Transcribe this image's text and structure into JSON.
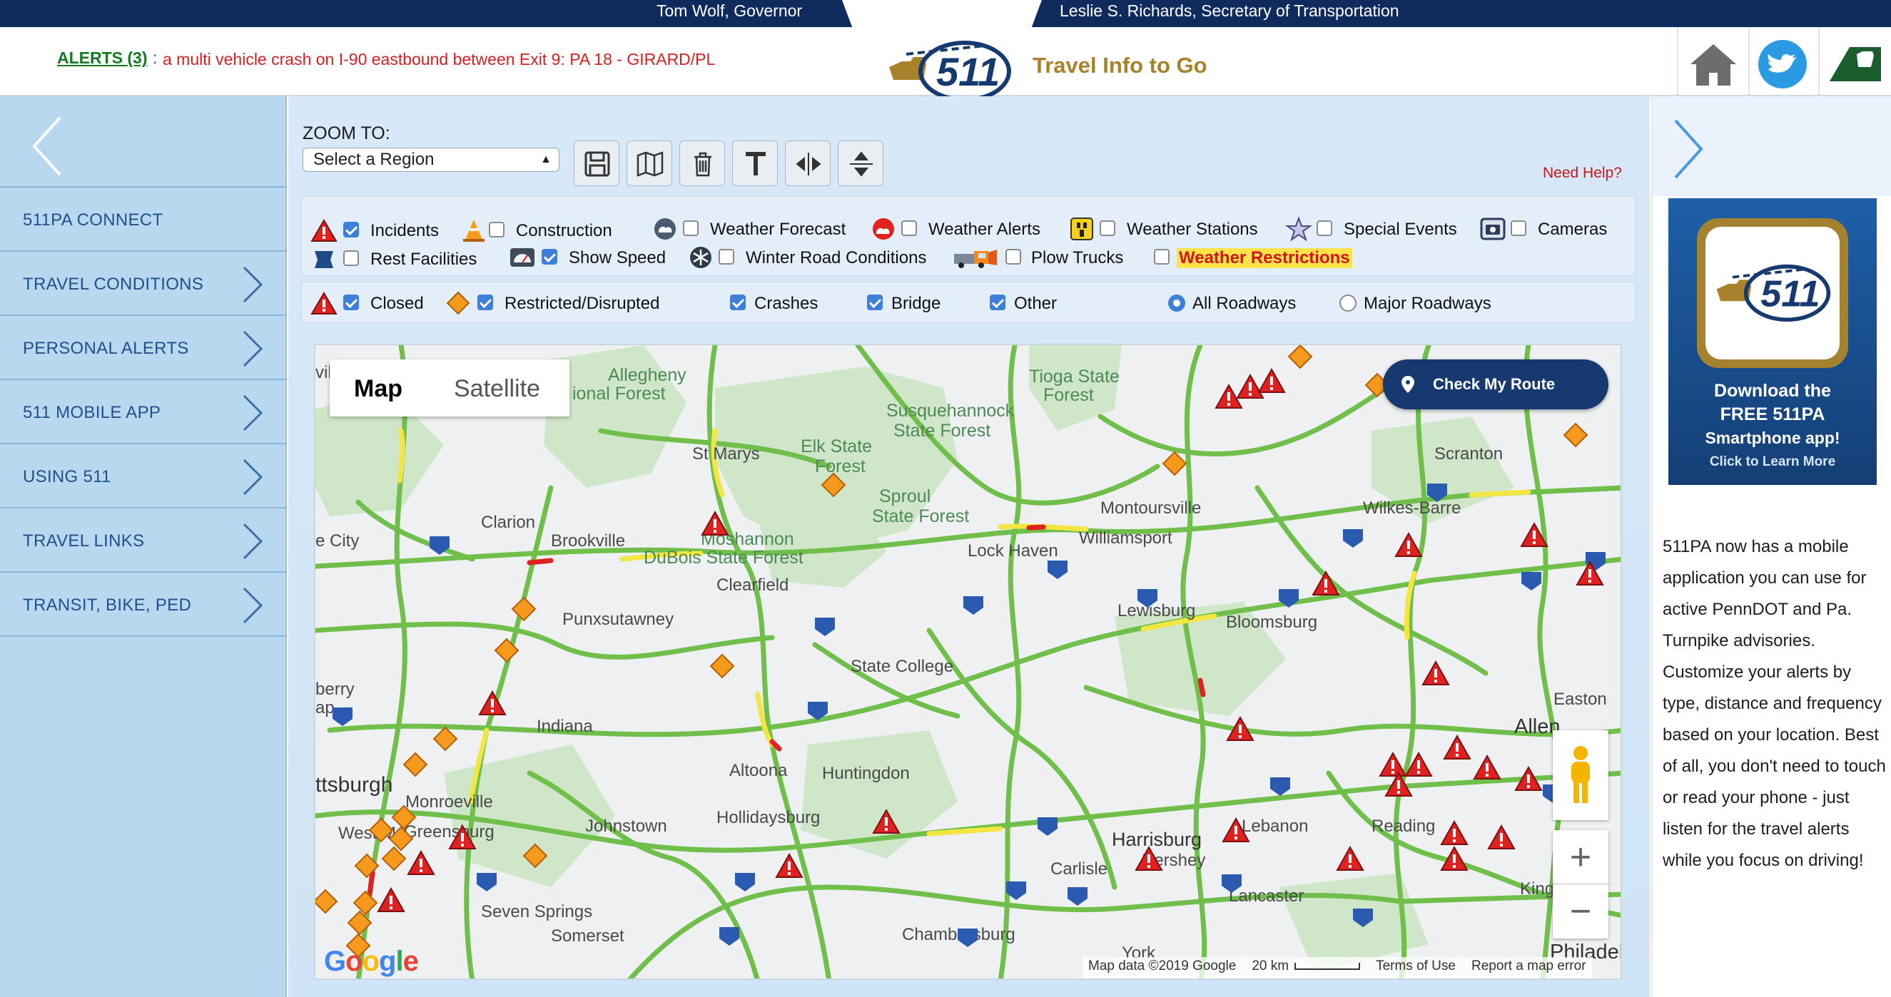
{
  "top_bar": {
    "governor": "Tom Wolf, Governor",
    "secretary": "Leslie S. Richards, Secretary of Transportation"
  },
  "header": {
    "alerts_label": "ALERTS (3)",
    "alerts_colon": ":",
    "alerts_text": "a multi vehicle crash on I-90 eastbound between Exit 9: PA 18 - GIRARD/PL",
    "logo_text": "511",
    "tagline": "Travel Info to Go",
    "icons": [
      "home-icon",
      "twitter-icon",
      "penndot-icon"
    ]
  },
  "sidebar": {
    "items": [
      {
        "label": "511PA CONNECT",
        "chevron": false
      },
      {
        "label": "TRAVEL CONDITIONS",
        "chevron": true
      },
      {
        "label": "PERSONAL ALERTS",
        "chevron": true
      },
      {
        "label": "511 MOBILE APP",
        "chevron": true
      },
      {
        "label": "USING 511",
        "chevron": true
      },
      {
        "label": "TRAVEL LINKS",
        "chevron": true
      },
      {
        "label": "TRANSIT, BIKE, PED",
        "chevron": true
      }
    ]
  },
  "toolbar": {
    "zoom_label": "ZOOM TO:",
    "region_select": "Select a Region",
    "tools": [
      "save-icon",
      "map-icon",
      "trash-icon",
      "text-icon",
      "split-vertical-icon",
      "split-horizontal-icon"
    ],
    "need_help": "Need Help?"
  },
  "layers": {
    "row1": [
      {
        "label": "Incidents",
        "checked": true,
        "icon": "incident-icon"
      },
      {
        "label": "Construction",
        "checked": false,
        "icon": "construction-icon"
      },
      {
        "label": "Weather Forecast",
        "checked": false,
        "icon": "weather-forecast-icon"
      },
      {
        "label": "Weather Alerts",
        "checked": false,
        "icon": "weather-alert-icon"
      },
      {
        "label": "Weather Stations",
        "checked": false,
        "icon": "weather-station-icon"
      },
      {
        "label": "Special Events",
        "checked": false,
        "icon": "star-icon"
      },
      {
        "label": "Cameras",
        "checked": false,
        "icon": "camera-icon"
      }
    ],
    "row2": [
      {
        "label": "Rest Facilities",
        "checked": false,
        "icon": "keystone-icon"
      },
      {
        "label": "Show Speed",
        "checked": true,
        "icon": "speedometer-icon"
      },
      {
        "label": "Winter Road Conditions",
        "checked": false,
        "icon": "snowflake-icon"
      },
      {
        "label": "Plow Trucks",
        "checked": false,
        "icon": "plow-truck-icon"
      },
      {
        "label": "Weather Restrictions",
        "checked": false,
        "icon": ""
      }
    ]
  },
  "filters": {
    "items": [
      {
        "label": "Closed",
        "checked": true,
        "icon": "incident-icon"
      },
      {
        "label": "Restricted/Disrupted",
        "checked": true,
        "icon": "diamond-icon"
      },
      {
        "label": "Crashes",
        "checked": true
      },
      {
        "label": "Bridge",
        "checked": true
      },
      {
        "label": "Other",
        "checked": true
      }
    ],
    "roadways": [
      {
        "label": "All Roadways",
        "selected": true
      },
      {
        "label": "Major Roadways",
        "selected": false
      }
    ]
  },
  "map": {
    "type_tabs": [
      {
        "label": "Map",
        "active": true
      },
      {
        "label": "Satellite",
        "active": false
      }
    ],
    "route_button": "Check My Route",
    "places_large": [
      "Susquehannock",
      "State Forest",
      "Sproul",
      "State Forest",
      "Elk State",
      "Forest",
      "Moshannon",
      "DuBois State Forest",
      "Tioga State",
      "Forest",
      "Allegheny",
      "ional Forest"
    ],
    "places": [
      "St Marys",
      "Clarion",
      "Brookville",
      "Clearfield",
      "Punxsutawney",
      "Lock Haven",
      "Williamsport",
      "Montoursville",
      "Lewisburg",
      "Bloomsburg",
      "Scranton",
      "Wilkes-Barre",
      "State College",
      "Indiana",
      "Altoona",
      "Huntingdon",
      "Johnstown",
      "Hollidaysburg",
      "ttsburgh",
      "Monroeville",
      "West M",
      "Greensburg",
      "Seven Springs",
      "Somerset",
      "Chambersburg",
      "Carlisle",
      "Harrisburg",
      "Hershey",
      "Lebanon",
      "Reading",
      "Lancaster",
      "York",
      "Philadel",
      "Allen",
      "Easton",
      "King",
      "berry",
      "ap",
      "e City",
      "vil"
    ],
    "zoom_in": "+",
    "zoom_out": "−",
    "google": "Google",
    "footer": {
      "data": "Map data ©2019 Google",
      "scale": "20 km",
      "terms": "Terms of Use",
      "report": "Report a map error"
    }
  },
  "right_panel": {
    "ad_line1": "Download the",
    "ad_line2": "FREE 511PA",
    "ad_line3": "Smartphone app!",
    "ad_line4": "Click to Learn More",
    "description": "511PA now has a mobile application you can use for active PennDOT and Pa. Turnpike advisories. Customize your alerts by type, distance and frequency based on your location. Best of all, you don't need to touch or read your phone - just listen for the travel alerts while you focus on driving!"
  },
  "colors": {
    "navy": "#0f2b5e",
    "alert_red": "#d81e1e",
    "alert_green": "#157a21",
    "gold": "#a8812b",
    "road_green": "#6fbf4a",
    "road_yellow": "#f4e642",
    "incident_red": "#e0211f",
    "restricted_orange": "#f59a1c"
  }
}
